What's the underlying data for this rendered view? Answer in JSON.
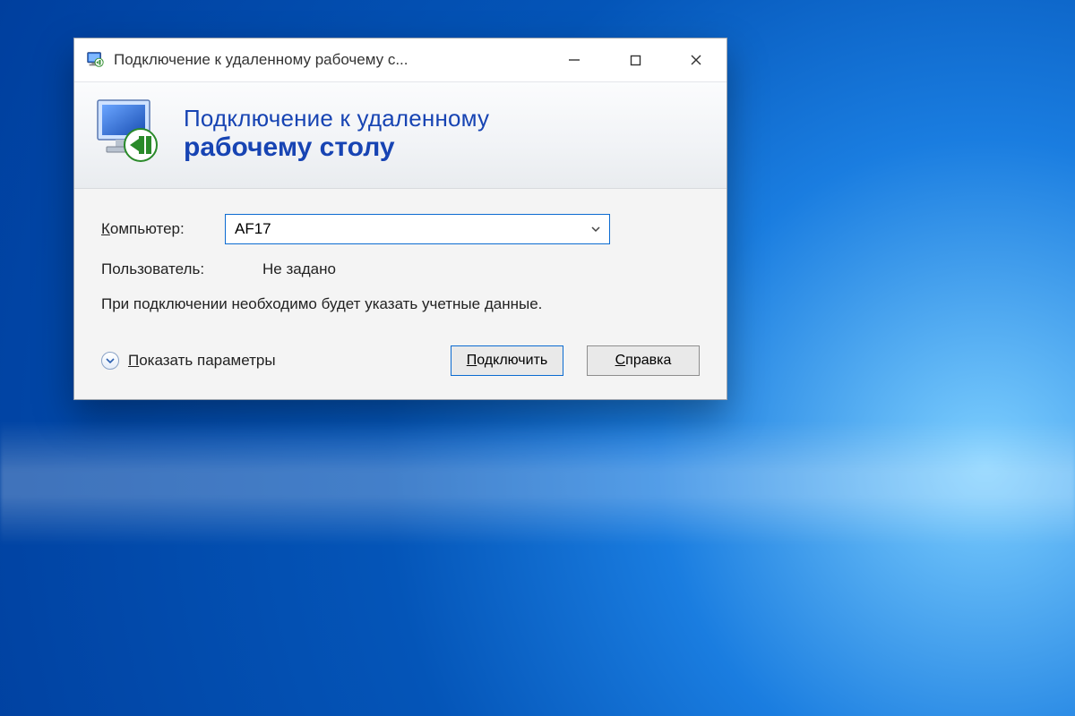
{
  "window": {
    "title": "Подключение к удаленному рабочему с..."
  },
  "header": {
    "line1": "Подключение к удаленному",
    "line2": "рабочему столу"
  },
  "form": {
    "computer_label_prefix": "К",
    "computer_label_rest": "омпьютер:",
    "computer_value": "AF17",
    "user_label": "Пользователь:",
    "user_value": "Не задано",
    "info_text": "При подключении необходимо будет указать учетные данные."
  },
  "footer": {
    "show_options_prefix": "П",
    "show_options_rest": "оказать параметры",
    "connect_prefix": "П",
    "connect_rest": "одключить",
    "help_prefix": "С",
    "help_rest": "правка"
  }
}
